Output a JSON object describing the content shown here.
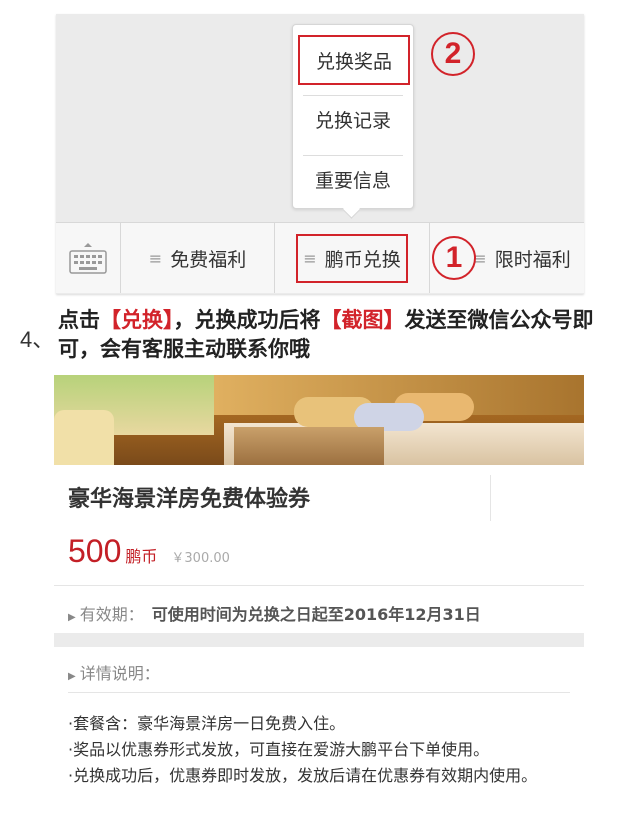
{
  "popup_menu": {
    "items": [
      "兑换奖品",
      "兑换记录",
      "重要信息"
    ]
  },
  "annotations": {
    "circle_1": "1",
    "circle_2": "2"
  },
  "menu_bar": {
    "lines_glyph": "≡",
    "items": [
      "免费福利",
      "鹏币兑换",
      "限时福利"
    ]
  },
  "instruction": {
    "step": "4、",
    "text_1": "点击",
    "highlight_1": "【兑换】",
    "text_2": "，兑换成功后将",
    "highlight_2": "【截图】",
    "text_3": "发送至微信公众号即可，会有客服主动联系你哦"
  },
  "product": {
    "name": "豪华海景洋房免费体验券",
    "price": "500",
    "price_unit": "鹏币",
    "original_price": "￥300.00",
    "validity_label": "有效期：",
    "validity_value": "可使用时间为兑换之日起至2016年12月31日",
    "details_label": "详情说明：",
    "details": [
      "·套餐含：豪华海景洋房一日免费入住。",
      "·奖品以优惠券形式发放，可直接在爱游大鹏平台下单使用。",
      "·兑换成功后，优惠券即时发放，发放后请在优惠券有效期内使用。"
    ]
  },
  "colors": {
    "accent_red": "#d2232a",
    "price_red": "#c31f26"
  }
}
